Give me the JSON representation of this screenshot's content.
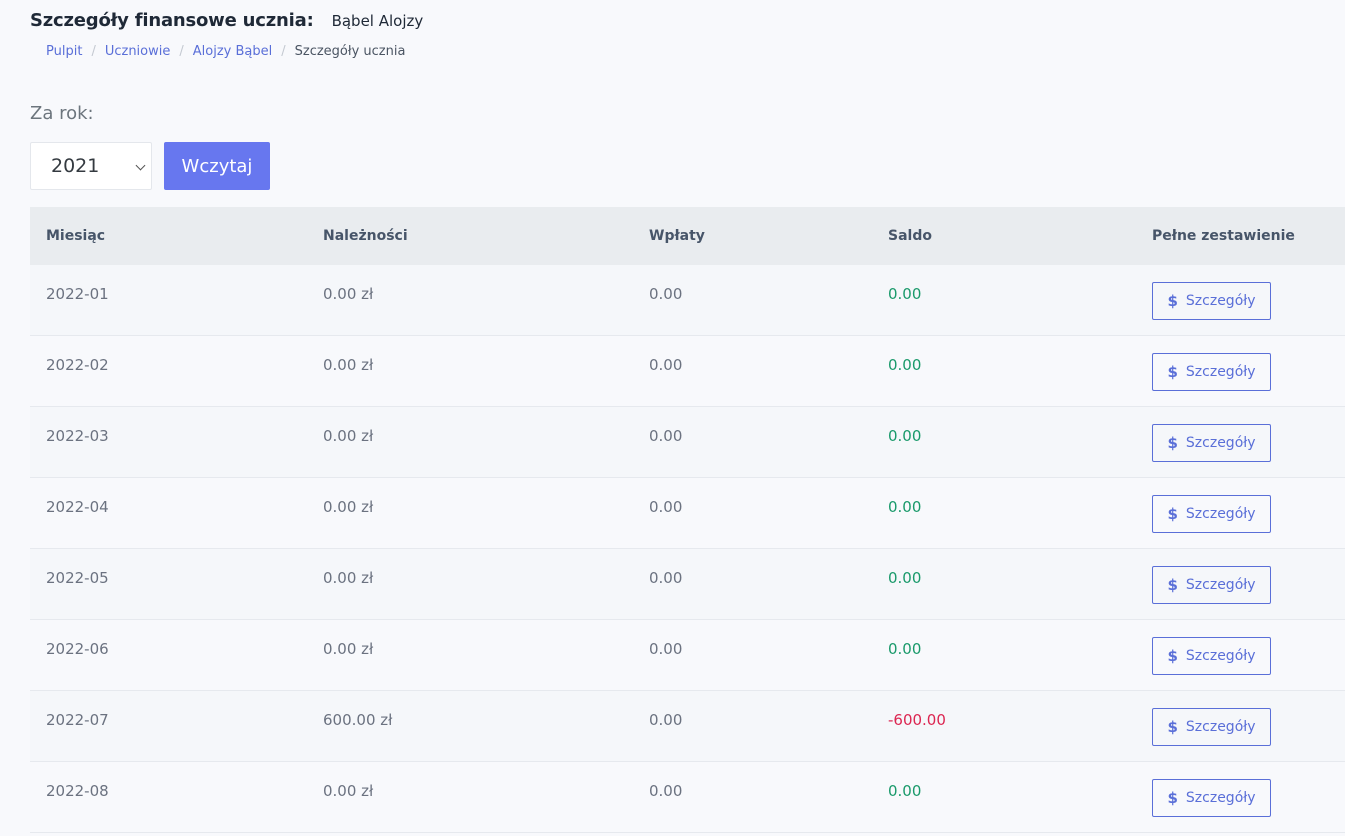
{
  "header": {
    "title": "Szczegóły finansowe ucznia:",
    "student_name": "Bąbel Alojzy"
  },
  "breadcrumb": {
    "items": [
      "Pulpit",
      "Uczniowie",
      "Alojzy Bąbel"
    ],
    "current": "Szczegóły ucznia"
  },
  "filter": {
    "label": "Za rok:",
    "year_selected": "2021",
    "load_button": "Wczytaj"
  },
  "table": {
    "columns": [
      "Miesiąc",
      "Należności",
      "Wpłaty",
      "Saldo",
      "Pełne zestawienie"
    ],
    "rows": [
      {
        "month": "2022-01",
        "dues": "0.00 zł",
        "payments": "0.00",
        "balance": "0.00",
        "status": "positive",
        "action": "Szczegóły"
      },
      {
        "month": "2022-02",
        "dues": "0.00 zł",
        "payments": "0.00",
        "balance": "0.00",
        "status": "positive",
        "action": "Szczegóły"
      },
      {
        "month": "2022-03",
        "dues": "0.00 zł",
        "payments": "0.00",
        "balance": "0.00",
        "status": "positive",
        "action": "Szczegóły"
      },
      {
        "month": "2022-04",
        "dues": "0.00 zł",
        "payments": "0.00",
        "balance": "0.00",
        "status": "positive",
        "action": "Szczegóły"
      },
      {
        "month": "2022-05",
        "dues": "0.00 zł",
        "payments": "0.00",
        "balance": "0.00",
        "status": "positive",
        "action": "Szczegóły"
      },
      {
        "month": "2022-06",
        "dues": "0.00 zł",
        "payments": "0.00",
        "balance": "0.00",
        "status": "positive",
        "action": "Szczegóły"
      },
      {
        "month": "2022-07",
        "dues": "600.00 zł",
        "payments": "0.00",
        "balance": "-600.00",
        "status": "negative",
        "action": "Szczegóły"
      },
      {
        "month": "2022-08",
        "dues": "0.00 zł",
        "payments": "0.00",
        "balance": "0.00",
        "status": "positive",
        "action": "Szczegóły"
      }
    ]
  },
  "icons": {
    "details": "dollar-icon"
  },
  "colors": {
    "accent": "#6777ef",
    "positive": "#1a9a6b",
    "negative": "#dc2651"
  }
}
